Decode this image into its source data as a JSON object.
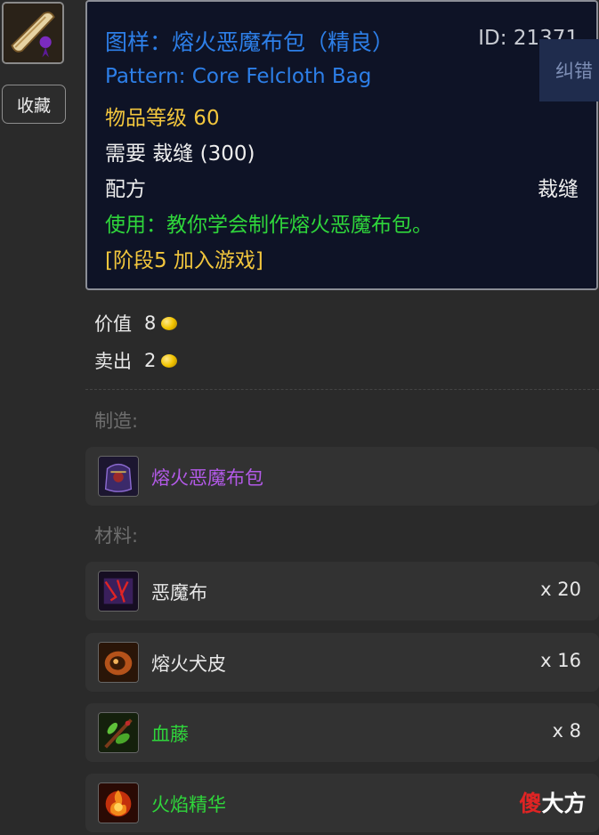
{
  "sidebar": {
    "favorite_label": "收藏"
  },
  "tooltip": {
    "title": "图样：熔火恶魔布包（精良）",
    "id_text": "ID: 21371",
    "english_name": "Pattern: Core Felcloth Bag",
    "item_level": "物品等级 60",
    "requirement": "需要 裁缝 (300)",
    "recipe_label": "配方",
    "recipe_type": "裁缝",
    "use_text": "使用：教你学会制作熔火恶魔布包。",
    "phase_text": "[阶段5 加入游戏]",
    "report_label": "纠错",
    "colors": {
      "title": "#2d7fe8",
      "level": "#f2c63d",
      "use": "#2fd63b"
    }
  },
  "price": {
    "value_label": "价值",
    "value_amount": "8",
    "sell_label": "卖出",
    "sell_amount": "2",
    "coin_icon": "gold-coin-icon"
  },
  "crafted": {
    "section_label": "制造:",
    "item": {
      "name": "熔火恶魔布包",
      "icon": "felcloth-bag-icon",
      "color": "#b35ae8"
    }
  },
  "materials": {
    "section_label": "材料:",
    "items": [
      {
        "name": "恶魔布",
        "qty": "x 20",
        "icon": "felcloth-icon"
      },
      {
        "name": "熔火犬皮",
        "qty": "x 16",
        "icon": "core-hound-hide-icon"
      },
      {
        "name": "血藤",
        "qty": "x 8",
        "icon": "bloodvine-icon"
      },
      {
        "name": "火焰精华",
        "qty": "",
        "icon": "essence-of-fire-icon"
      }
    ]
  },
  "watermark": {
    "char1": "傻",
    "char2": "大方"
  }
}
